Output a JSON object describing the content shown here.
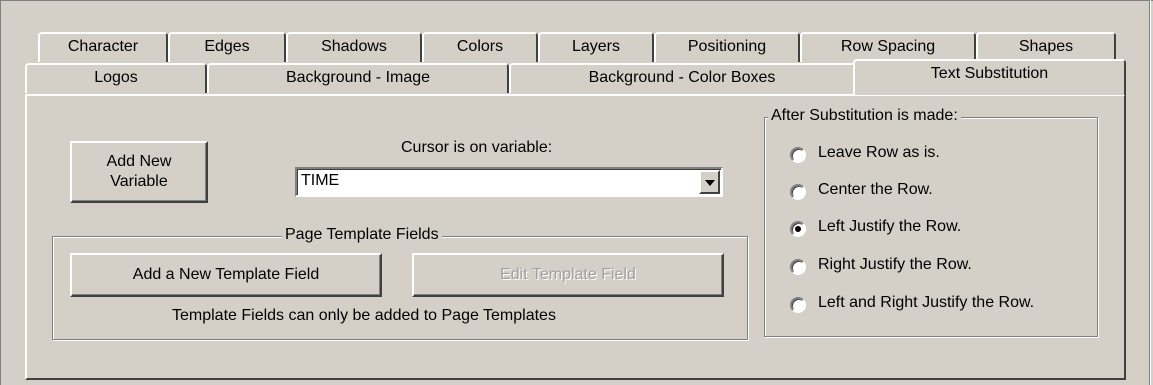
{
  "tabs_row1": [
    "Character",
    "Edges",
    "Shadows",
    "Colors",
    "Layers",
    "Positioning",
    "Row Spacing",
    "Shapes"
  ],
  "tabs_row2": [
    "Logos",
    "Background - Image",
    "Background - Color Boxes",
    "Text Substitution"
  ],
  "active_tab": "Text Substitution",
  "add_variable_button": {
    "line1": "Add New",
    "line2": "Variable"
  },
  "cursor_label": "Cursor is on variable:",
  "variable_select": {
    "value": "TIME"
  },
  "template_group": {
    "title": "Page Template Fields",
    "add_button": "Add a New Template Field",
    "edit_button": "Edit Template Field",
    "edit_enabled": false,
    "note": "Template Fields can only be added to Page Templates"
  },
  "after_group": {
    "title": "After Substitution is made:",
    "options": [
      {
        "label": "Leave Row as is.",
        "selected": false
      },
      {
        "label": "Center the Row.",
        "selected": false
      },
      {
        "label": "Left Justify the Row.",
        "selected": true
      },
      {
        "label": "Right Justify the Row.",
        "selected": false
      },
      {
        "label": "Left and Right Justify the Row.",
        "selected": false
      }
    ]
  }
}
